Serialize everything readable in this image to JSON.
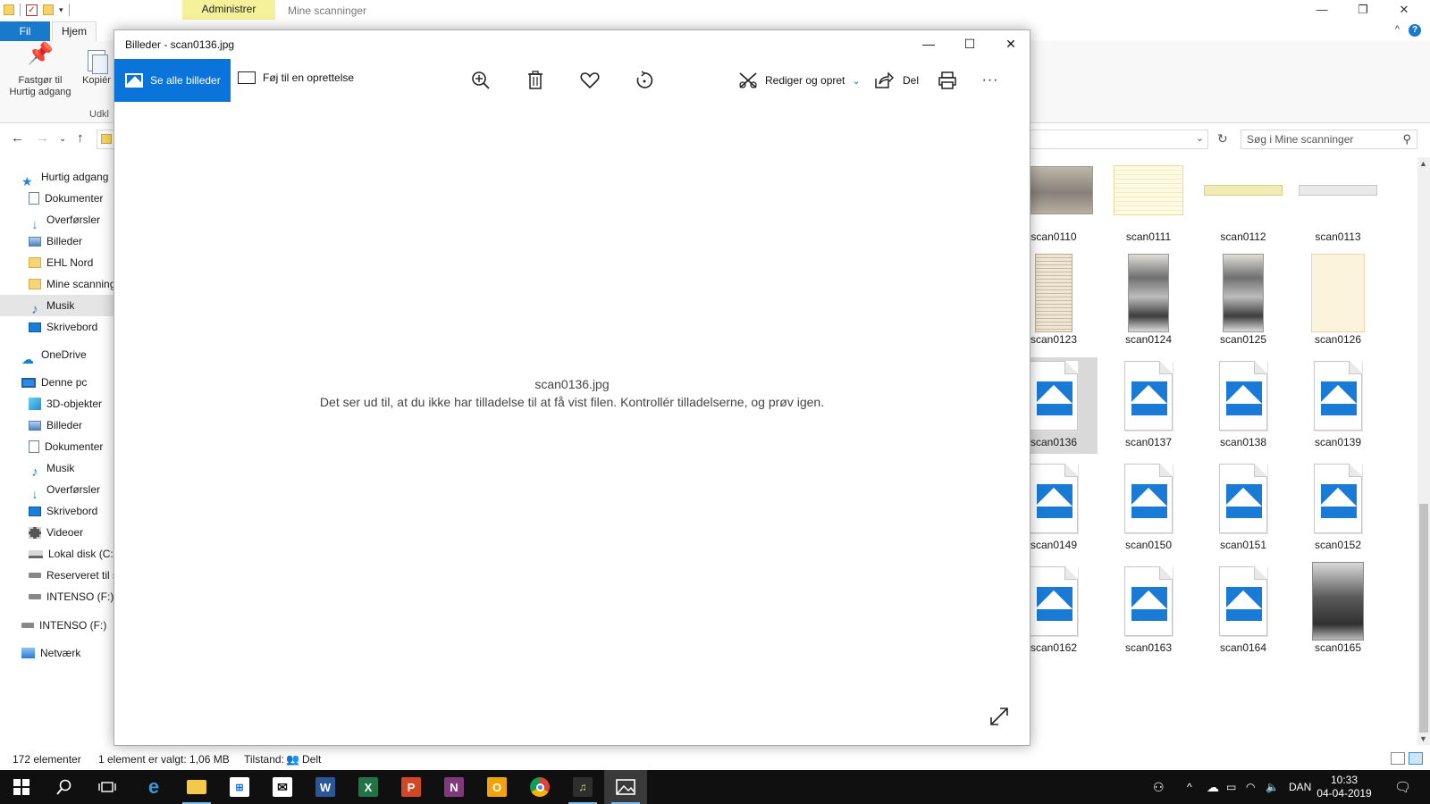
{
  "explorer": {
    "window_title": "Mine scanninger",
    "context_tab": "Administrer",
    "tabs": {
      "file": "Fil",
      "home": "Hjem"
    },
    "ribbon": {
      "pin_label_1": "Fastgør til",
      "pin_label_2": "Hurtig adgang",
      "copy_label": "Kopiér",
      "group_label": "Udkl"
    },
    "search_placeholder": "Søg i Mine scanninger",
    "nav": {
      "quick_access": "Hurtig adgang",
      "quick_items": [
        "Dokumenter",
        "Overførsler",
        "Billeder",
        "EHL Nord",
        "Mine scanninger",
        "Musik",
        "Skrivebord"
      ],
      "onedrive": "OneDrive",
      "this_pc": "Denne pc",
      "pc_items": [
        "3D-objekter",
        "Billeder",
        "Dokumenter",
        "Musik",
        "Overførsler",
        "Skrivebord",
        "Videoer",
        "Lokal disk (C:)",
        "Reserveret til s",
        "INTENSO (F:)"
      ],
      "intenso": "INTENSO (F:)",
      "network": "Netværk"
    },
    "files": [
      {
        "name": "scan0110",
        "thumb": "photo"
      },
      {
        "name": "scan0111",
        "thumb": "ledger"
      },
      {
        "name": "scan0112",
        "thumb": "strip"
      },
      {
        "name": "scan0113",
        "thumb": "strip2"
      },
      {
        "name": "scan0123",
        "thumb": "news"
      },
      {
        "name": "scan0124",
        "thumb": "team"
      },
      {
        "name": "scan0125",
        "thumb": "team"
      },
      {
        "name": "scan0126",
        "thumb": "card"
      },
      {
        "name": "scan0136",
        "thumb": "icon",
        "selected": true
      },
      {
        "name": "scan0137",
        "thumb": "icon"
      },
      {
        "name": "scan0138",
        "thumb": "icon"
      },
      {
        "name": "scan0139",
        "thumb": "icon"
      },
      {
        "name": "scan0149",
        "thumb": "icon"
      },
      {
        "name": "scan0150",
        "thumb": "icon"
      },
      {
        "name": "scan0151",
        "thumb": "icon"
      },
      {
        "name": "scan0152",
        "thumb": "icon"
      },
      {
        "name": "scan0162",
        "thumb": "icon"
      },
      {
        "name": "scan0163",
        "thumb": "icon"
      },
      {
        "name": "scan0164",
        "thumb": "icon"
      },
      {
        "name": "scan0165",
        "thumb": "people"
      }
    ],
    "status": {
      "count": "172 elementer",
      "selected": "1 element er valgt: 1,06 MB",
      "state_label": "Tilstand:",
      "state_value": "Delt"
    }
  },
  "photos": {
    "title": "Billeder - scan0136.jpg",
    "see_all": "Se alle billeder",
    "add_to_creation": "Føj til en oprettelse",
    "edit_create": "Rediger og opret",
    "share": "Del",
    "more": "···",
    "file_name": "scan0136.jpg",
    "error_message": "Det ser ud til, at du ikke har tilladelse til at få vist filen. Kontrollér tilladelserne, og prøv igen."
  },
  "taskbar": {
    "language": "DAN",
    "time": "10:33",
    "date": "04-04-2019"
  },
  "colors": {
    "accent": "#0a74da",
    "file_tab": "#1979ca",
    "context_tab": "#f5f19a",
    "taskbar": "#101010"
  }
}
